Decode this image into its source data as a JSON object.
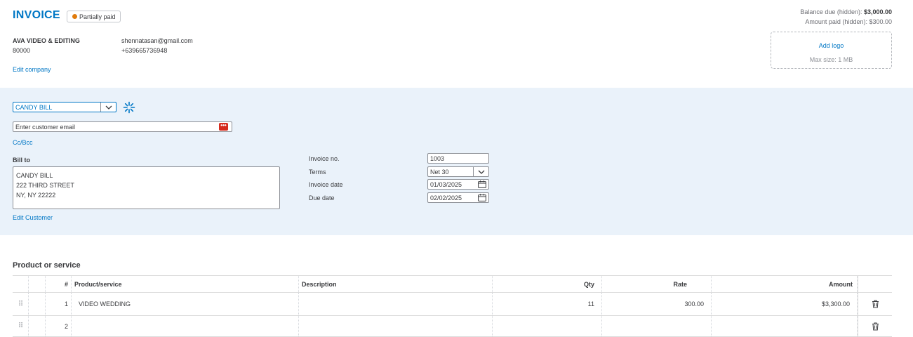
{
  "header": {
    "title": "INVOICE",
    "status": "Partially paid",
    "balance_due_label": "Balance due (hidden): ",
    "balance_due_value": "$3,000.00",
    "amount_paid": "Amount paid (hidden): $300.00"
  },
  "company": {
    "name": "AVA VIDEO & EDITING",
    "number": "80000",
    "email": "shennatasan@gmail.com",
    "phone": "+639665736948",
    "edit_link": "Edit company"
  },
  "logo": {
    "add_label": "Add logo",
    "max_size": "Max size: 1 MB"
  },
  "customer": {
    "selected": "CANDY BILL",
    "email_placeholder": "Enter customer email",
    "ccbcc_link": "Cc/Bcc",
    "bill_to_label": "Bill to",
    "bill_to_lines": [
      "CANDY BILL",
      "222 THIRD STREET",
      "NY, NY  22222"
    ],
    "edit_link": "Edit Customer"
  },
  "invoice_meta": {
    "invoice_no_label": "Invoice no.",
    "invoice_no": "1003",
    "terms_label": "Terms",
    "terms": "Net 30",
    "invoice_date_label": "Invoice date",
    "invoice_date": "01/03/2025",
    "due_date_label": "Due date",
    "due_date": "02/02/2025"
  },
  "products": {
    "heading": "Product or service",
    "columns": {
      "num": "#",
      "product": "Product/service",
      "description": "Description",
      "qty": "Qty",
      "rate": "Rate",
      "amount": "Amount"
    },
    "rows": [
      {
        "num": "1",
        "product": "VIDEO WEDDING",
        "description": "",
        "qty": "11",
        "rate": "300.00",
        "amount": "$3,300.00"
      },
      {
        "num": "2",
        "product": "",
        "description": "",
        "qty": "",
        "rate": "",
        "amount": ""
      }
    ]
  },
  "colors": {
    "accent": "#0077c5",
    "band": "#eaf2fa",
    "status_dot": "#e07b0c"
  }
}
